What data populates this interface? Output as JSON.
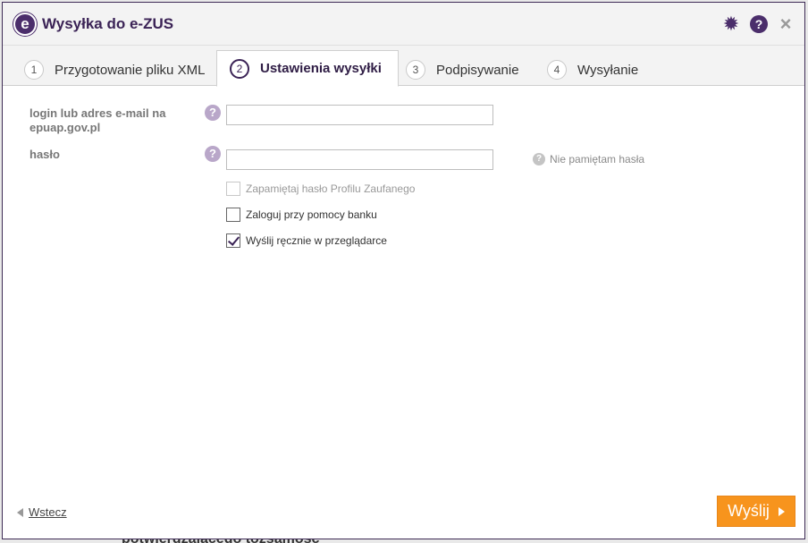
{
  "window": {
    "title": "Wysyłka do e-ZUS",
    "logo_letter": "e"
  },
  "toolbar": {
    "help_glyph": "?",
    "close_glyph": "×"
  },
  "tabs": [
    {
      "num": "1",
      "label": "Przygotowanie pliku XML"
    },
    {
      "num": "2",
      "label": "Ustawienia wysyłki"
    },
    {
      "num": "3",
      "label": "Podpisywanie"
    },
    {
      "num": "4",
      "label": "Wysyłanie"
    }
  ],
  "form": {
    "login_label": "login lub adres e-mail na epuap.gov.pl",
    "login_value": "",
    "password_label": "hasło",
    "password_value": "",
    "help_glyph": "?",
    "forgot_password": "Nie pamiętam hasła",
    "options": [
      {
        "label": "Zapamiętaj hasło Profilu Zaufanego",
        "checked": false,
        "disabled": true
      },
      {
        "label": "Zaloguj przy pomocy banku",
        "checked": false,
        "disabled": false
      },
      {
        "label": "Wyślij ręcznie w przeglądarce",
        "checked": true,
        "disabled": false
      }
    ]
  },
  "footer": {
    "back_label": "Wstecz",
    "send_label": "Wyślij"
  },
  "background": {
    "text": "potwierdzającego tożsamość"
  },
  "colors": {
    "accent": "#4b2e6b",
    "send_button": "#f7941d"
  }
}
